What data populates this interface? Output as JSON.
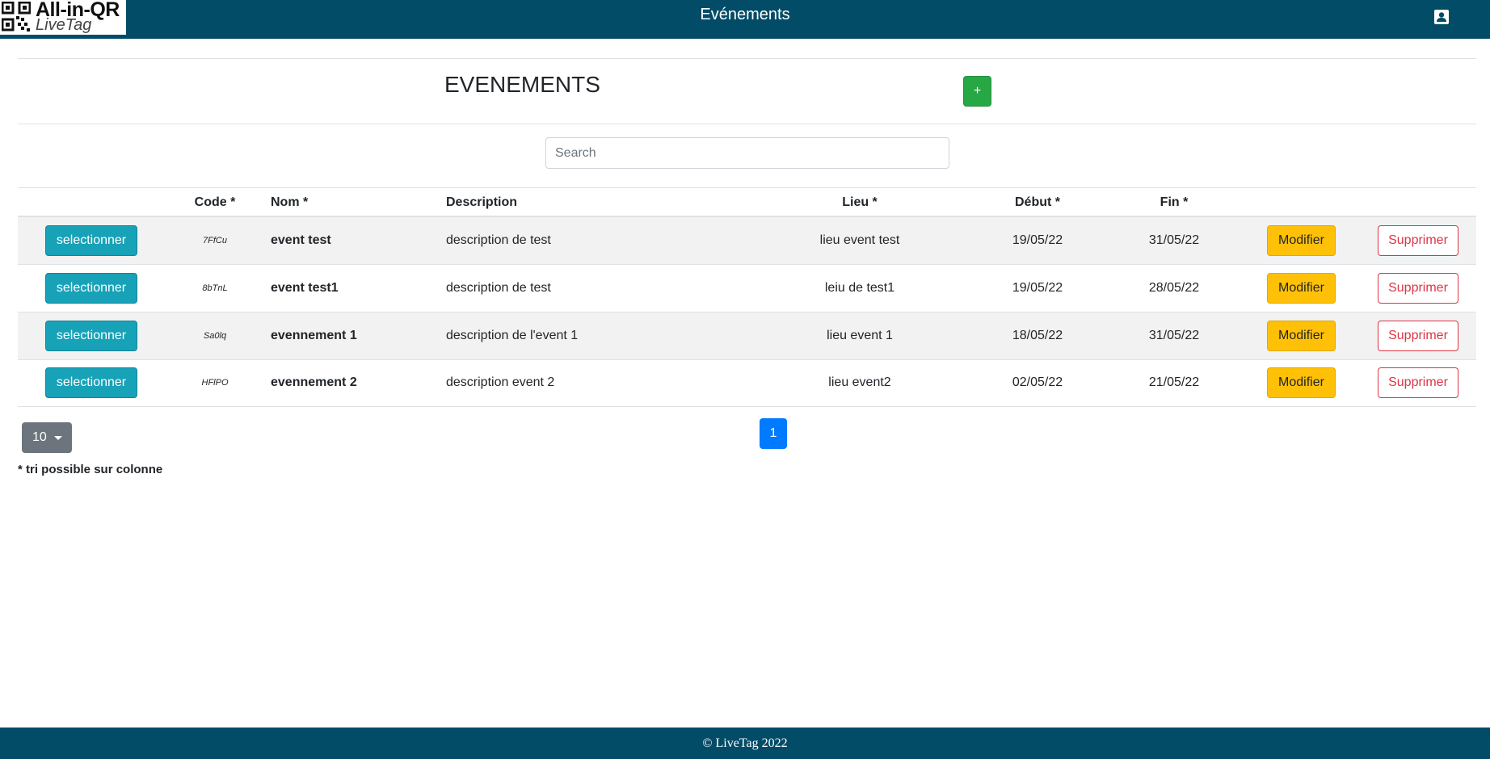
{
  "navbar": {
    "logo_text_1": "All-in-QR",
    "logo_text_2": "LiveTag",
    "title": "Evénements",
    "user_icon": "user-account-icon",
    "background": "#034c68"
  },
  "header": {
    "title": "EVENEMENTS",
    "add_label": "+"
  },
  "search": {
    "placeholder": "Search",
    "value": ""
  },
  "table": {
    "columns": {
      "code": "Code *",
      "name": "Nom *",
      "description": "Description",
      "place": "Lieu *",
      "start": "Début *",
      "end": "Fin *"
    },
    "rows": [
      {
        "select_label": "selectionner",
        "code": "7FfCu",
        "name": "event test",
        "description": "description de test",
        "place": "lieu event test",
        "start": "19/05/22",
        "end": "31/05/22",
        "modify_label": "Modifier",
        "delete_label": "Supprimer"
      },
      {
        "select_label": "selectionner",
        "code": "8bTnL",
        "name": "event test1",
        "description": "description de test",
        "place": "leiu de test1",
        "start": "19/05/22",
        "end": "28/05/22",
        "modify_label": "Modifier",
        "delete_label": "Supprimer"
      },
      {
        "select_label": "selectionner",
        "code": "Sa0lq",
        "name": "evennement 1",
        "description": "description de l'event 1",
        "place": "lieu event 1",
        "start": "18/05/22",
        "end": "31/05/22",
        "modify_label": "Modifier",
        "delete_label": "Supprimer"
      },
      {
        "select_label": "selectionner",
        "code": "HFlPO",
        "name": "evennement 2",
        "description": "description event 2",
        "place": "lieu event2",
        "start": "02/05/22",
        "end": "21/05/22",
        "modify_label": "Modifier",
        "delete_label": "Supprimer"
      }
    ]
  },
  "pagination": {
    "page_size": "10",
    "current_page": "1"
  },
  "sort_note": "* tri possible sur colonne",
  "footer": {
    "text": "© LiveTag 2022"
  },
  "colors": {
    "brand": "#034c68",
    "add": "#28a745",
    "select": "#17a2b8",
    "modify": "#ffc107",
    "delete": "#dc3545",
    "page": "#007bff"
  }
}
